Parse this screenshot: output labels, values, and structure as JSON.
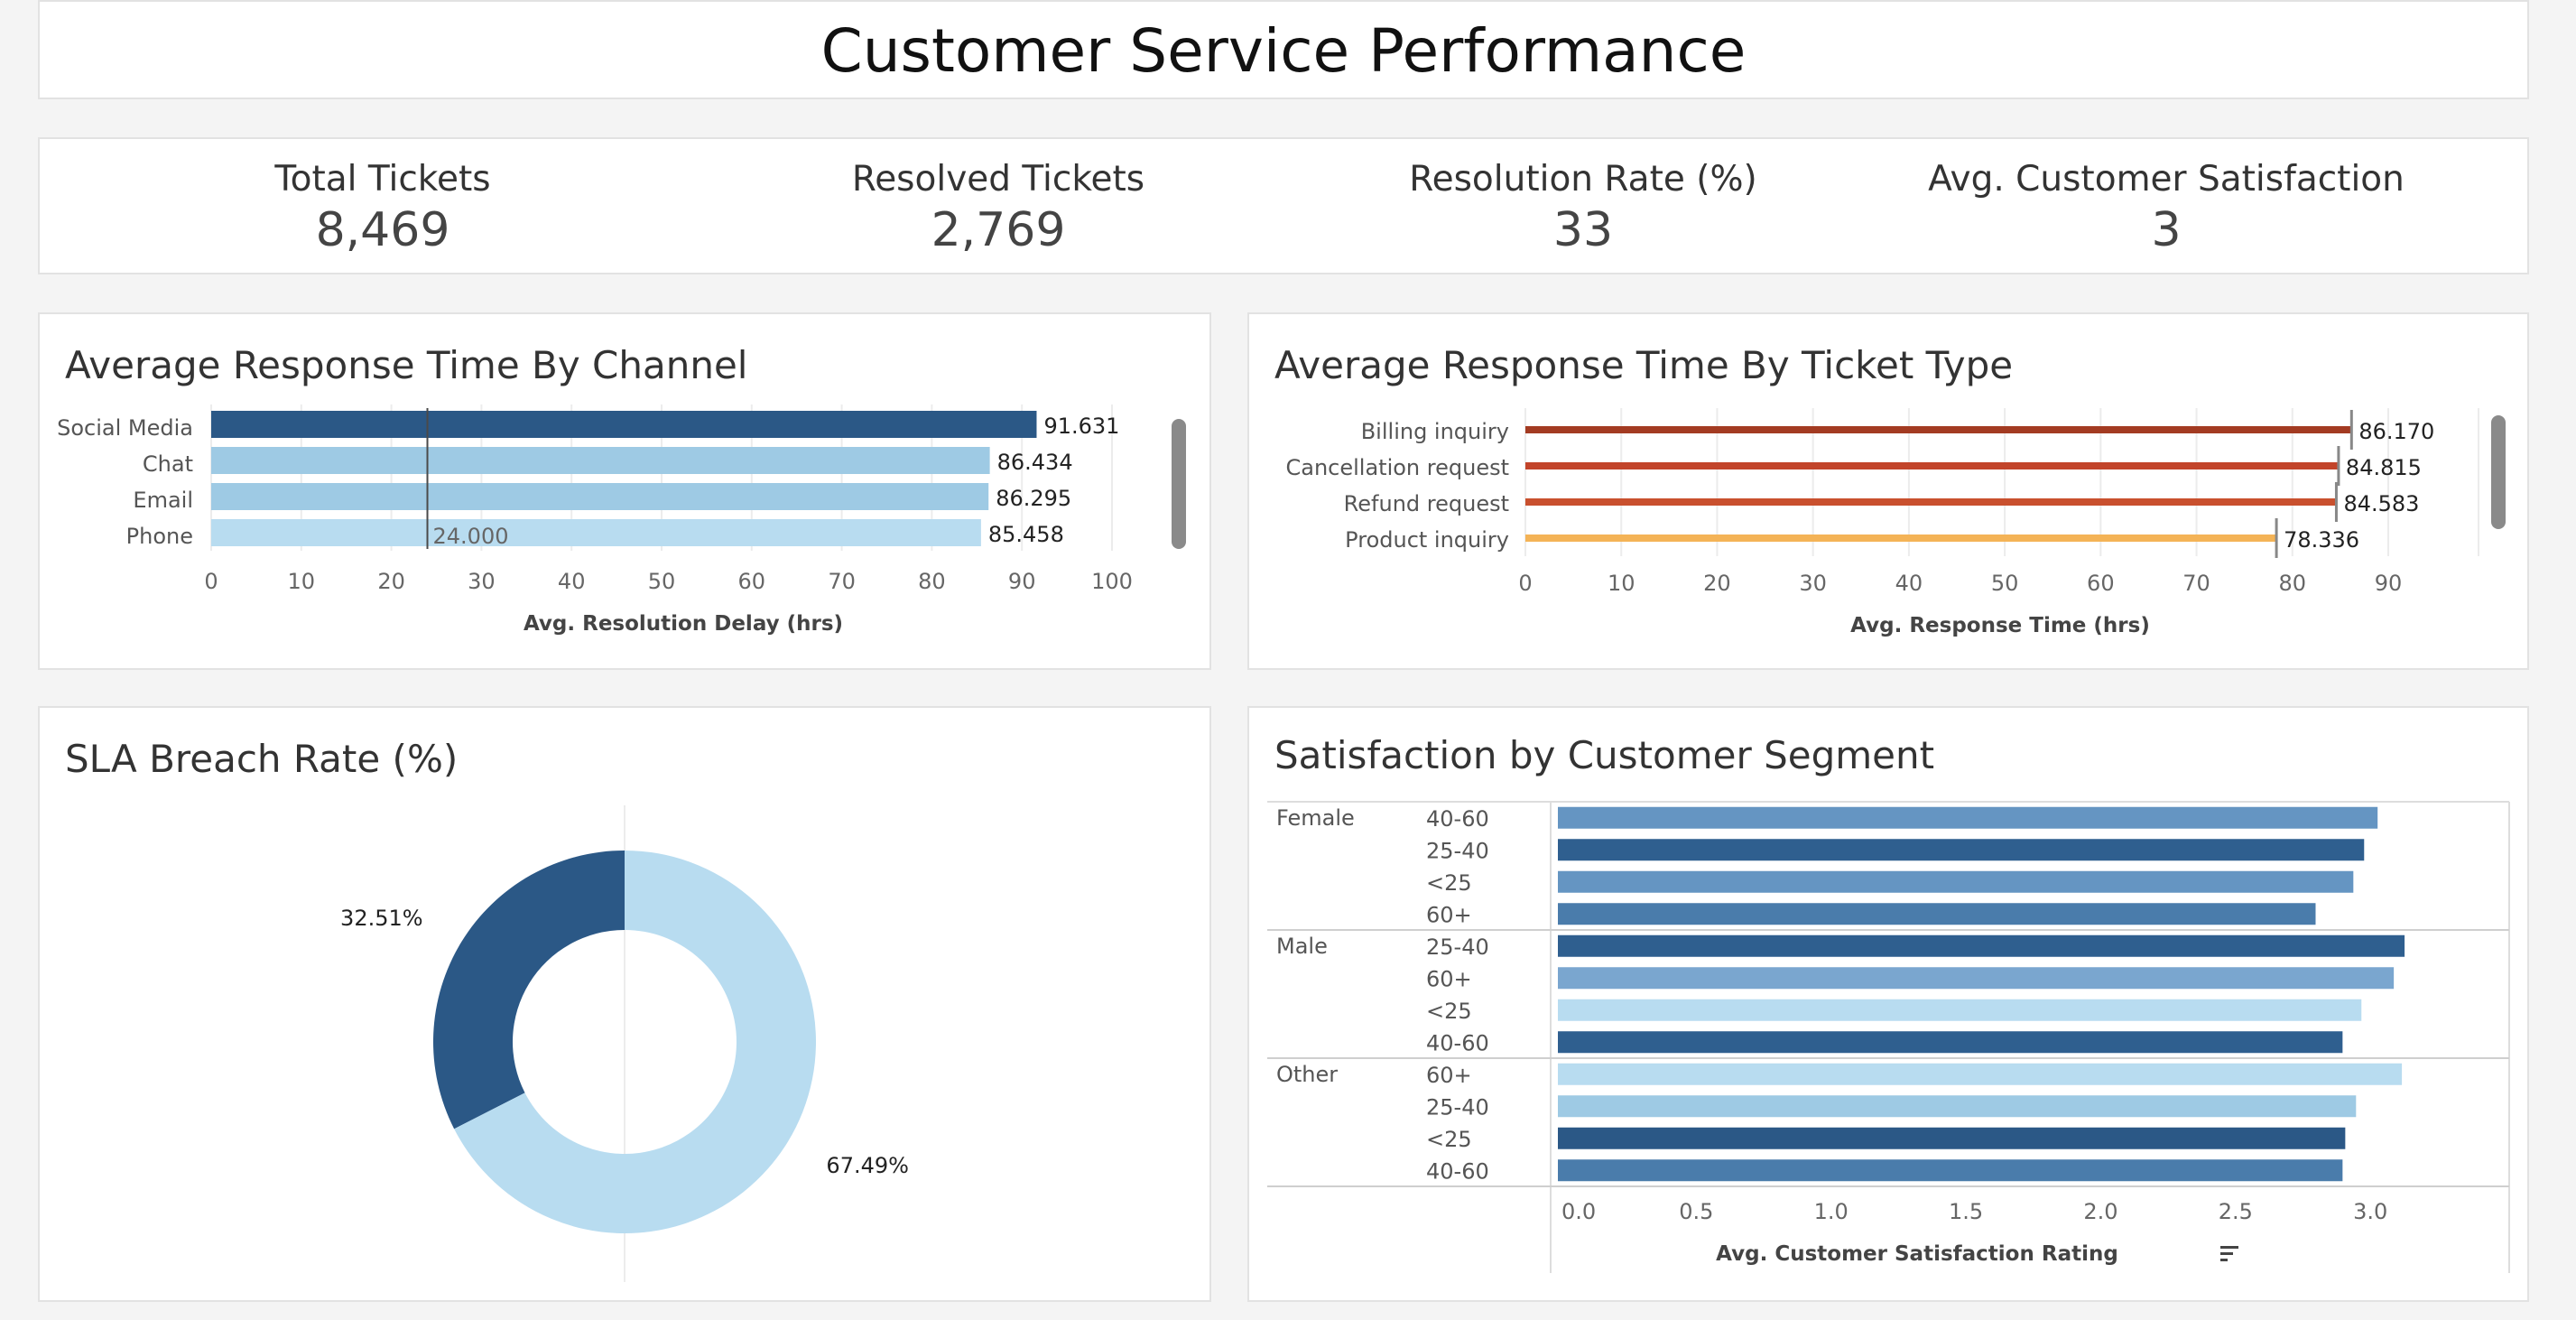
{
  "title": "Customer Service Performance",
  "kpis": [
    {
      "label": "Total Tickets",
      "value": "8,469"
    },
    {
      "label": "Resolved Tickets",
      "value": "2,769"
    },
    {
      "label": "Resolution Rate (%)",
      "value": "33"
    },
    {
      "label": "Avg. Customer Satisfaction",
      "value": "3"
    }
  ],
  "charts": {
    "channel": {
      "title": "Average Response Time By Channel"
    },
    "type": {
      "title": "Average Response Time By Ticket Type"
    },
    "sla": {
      "title": "SLA Breach Rate (%)"
    },
    "segment": {
      "title": "Satisfaction by Customer Segment"
    }
  },
  "chart_data": [
    {
      "id": "channel",
      "type": "bar",
      "orientation": "horizontal",
      "title": "Average Response Time By Channel",
      "categories": [
        "Social Media",
        "Chat",
        "Email",
        "Phone"
      ],
      "values": [
        91.631,
        86.434,
        86.295,
        85.458
      ],
      "value_labels": [
        "91.631",
        "86.434",
        "86.295",
        "85.458"
      ],
      "colors": [
        "#2b5886",
        "#9ecae4",
        "#9ecae4",
        "#b8dcf0"
      ],
      "reference_line": {
        "value": 24,
        "label": "24.000"
      },
      "xlabel": "Avg. Resolution Delay (hrs)",
      "xticks": [
        0,
        10,
        20,
        30,
        40,
        50,
        60,
        70,
        80,
        90,
        100
      ],
      "xlim": [
        0,
        100
      ],
      "grid": true
    },
    {
      "id": "type",
      "type": "bar",
      "orientation": "horizontal",
      "title": "Average Response Time By Ticket Type",
      "categories": [
        "Billing inquiry",
        "Cancellation request",
        "Refund request",
        "Product inquiry"
      ],
      "values": [
        86.17,
        84.815,
        84.583,
        78.336
      ],
      "value_labels": [
        "86.170",
        "84.815",
        "84.583",
        "78.336"
      ],
      "colors": [
        "#a33b22",
        "#c2442a",
        "#c9502e",
        "#f4b356"
      ],
      "xlabel": "Avg. Response Time (hrs)",
      "xticks": [
        0,
        10,
        20,
        30,
        40,
        50,
        60,
        70,
        80,
        90
      ],
      "xlim": [
        0,
        90
      ],
      "grid": true
    },
    {
      "id": "sla",
      "type": "pie",
      "donut": true,
      "title": "SLA Breach Rate (%)",
      "slices": [
        {
          "value": 32.51,
          "label": "32.51%",
          "color": "#2b5886"
        },
        {
          "value": 67.49,
          "label": "67.49%",
          "color": "#b8dcf0"
        }
      ]
    },
    {
      "id": "segment",
      "type": "bar",
      "orientation": "horizontal",
      "title": "Satisfaction by Customer Segment",
      "groups": [
        {
          "name": "Female",
          "rows": [
            {
              "label": "40-60",
              "value": 3.04,
              "color": "#6595c2"
            },
            {
              "label": "25-40",
              "value": 2.99,
              "color": "#2f5f8f"
            },
            {
              "label": "<25",
              "value": 2.95,
              "color": "#6595c2"
            },
            {
              "label": "60+",
              "value": 2.81,
              "color": "#4a7cab"
            }
          ]
        },
        {
          "name": "Male",
          "rows": [
            {
              "label": "25-40",
              "value": 3.14,
              "color": "#2f5f8f"
            },
            {
              "label": "60+",
              "value": 3.1,
              "color": "#7aa6cf"
            },
            {
              "label": "<25",
              "value": 2.98,
              "color": "#b8dcf0"
            },
            {
              "label": "40-60",
              "value": 2.91,
              "color": "#2f5f8f"
            }
          ]
        },
        {
          "name": "Other",
          "rows": [
            {
              "label": "60+",
              "value": 3.13,
              "color": "#b8dcf0"
            },
            {
              "label": "25-40",
              "value": 2.96,
              "color": "#9ecae4"
            },
            {
              "label": "<25",
              "value": 2.92,
              "color": "#2b5886"
            },
            {
              "label": "40-60",
              "value": 2.91,
              "color": "#4a7cab"
            }
          ]
        }
      ],
      "xlabel": "Avg. Customer Satisfaction Rating",
      "xticks": [
        "0.0",
        "0.5",
        "1.0",
        "1.5",
        "2.0",
        "2.5",
        "3.0"
      ],
      "xlim": [
        0,
        3.2
      ],
      "grid": true
    }
  ]
}
